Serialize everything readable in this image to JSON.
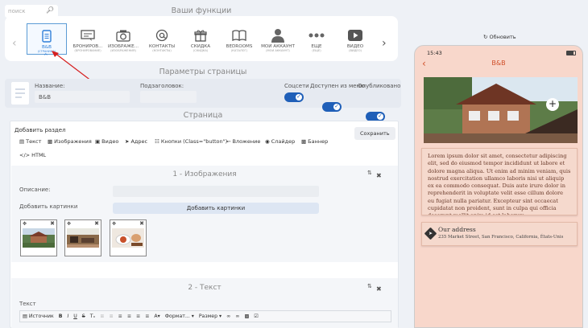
{
  "search": {
    "placeholder": "поиск"
  },
  "functions": {
    "title": "Ваши функции",
    "items": [
      {
        "label": "B&B",
        "sub": "(СТРАНИЦА)",
        "icon": "document-icon",
        "active": true
      },
      {
        "label": "БРОНИРОВ...",
        "sub": "(БРОНИРОВАНИЕ)",
        "icon": "booking-icon"
      },
      {
        "label": "ИЗОБРАЖЕ...",
        "sub": "(ИЗОБРАЖЕНИЯ)",
        "icon": "camera-icon"
      },
      {
        "label": "КОНТАКТЫ",
        "sub": "(КОНТАКТЫ)",
        "icon": "at-icon"
      },
      {
        "label": "СКИДКА",
        "sub": "(СКИДКА)",
        "icon": "gift-icon"
      },
      {
        "label": "BEDROOMS",
        "sub": "(КАТАЛОГ)",
        "icon": "book-icon"
      },
      {
        "label": "МОЙ АККАУНТ",
        "sub": "(МОЙ АККАУНТ)",
        "icon": "user-icon"
      },
      {
        "label": "ЕЩЁ",
        "sub": "(ЕЩЁ)",
        "icon": "more-icon"
      },
      {
        "label": "ВИДЕО",
        "sub": "(ВИДЕО)",
        "icon": "video-icon"
      }
    ]
  },
  "params": {
    "title": "Параметры страницы",
    "name_label": "Название:",
    "name_value": "B&B",
    "subtitle_label": "Подзаголовок:",
    "subtitle_value": "",
    "social_label": "Соцсети",
    "menu_label": "Доступен из меню",
    "published_label": "Опубликовано"
  },
  "page": {
    "title": "Страница",
    "add_section": "Добавить раздел",
    "save": "Сохранить",
    "tools": [
      "Текст",
      "Изображения",
      "Видео",
      "Адрес",
      "Кнопки (Class=\"button\")",
      "Вложение",
      "Слайдер",
      "Баннер",
      "HTML"
    ]
  },
  "section1": {
    "title": "1 - Изображения",
    "description_label": "Описание:",
    "add_images_label": "Добавить картинки",
    "add_images_button": "Добавить картинки"
  },
  "section2": {
    "title": "2 - Текст",
    "text_label": "Текст",
    "toolbar": {
      "source": "Источник",
      "format": "Формат...",
      "size": "Размер"
    }
  },
  "preview": {
    "refresh": "Обновить",
    "time": "15:43",
    "title": "B&B",
    "lorem": "Lorem ipsum dolor sit amet, consectetur adipiscing elit, sed do eiusmod tempor incididunt ut labore et dolore magna aliqua. Ut enim ad minim veniam, quis nostrud exercitation ullamco laboris nisi ut aliquip ex ea commodo consequat. Duis aute irure dolor in reprehenderit in voluptate velit esse cillum dolore eu fugiat nulla pariatur. Excepteur sint occaecat cupidatat non proident, sunt in culpa qui officia deserunt mollit anim id est laborum.",
    "address_title": "Our address",
    "address": "235 Market Street, San Francisco, California, États-Unis"
  },
  "colors": {
    "accent": "#2f7fd8",
    "toggle": "#1f5fb8",
    "preview_bg": "#f8d7cb",
    "arrow": "#d62020"
  }
}
